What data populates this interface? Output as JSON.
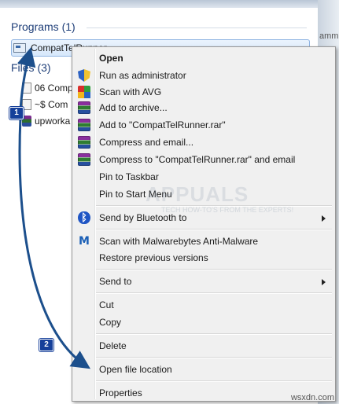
{
  "search_panel": {
    "programs_header": "Programs (1)",
    "programs": [
      {
        "name": "CompatTelRunner"
      }
    ],
    "files_header": "Files (3)",
    "files": [
      {
        "name": "06 Comp"
      },
      {
        "name": "~$ Com"
      },
      {
        "name": "upworka"
      }
    ],
    "clipped_right_text": "amm"
  },
  "context_menu": {
    "items": [
      {
        "label": "Open",
        "bold": true,
        "icon": null
      },
      {
        "label": "Run as administrator",
        "icon": "shield-icon"
      },
      {
        "label": "Scan with AVG",
        "icon": "avg-icon"
      },
      {
        "label": "Add to archive...",
        "icon": "rar-icon"
      },
      {
        "label": "Add to \"CompatTelRunner.rar\"",
        "icon": "rar-icon"
      },
      {
        "label": "Compress and email...",
        "icon": "rar-icon"
      },
      {
        "label": "Compress to \"CompatTelRunner.rar\" and email",
        "icon": "rar-icon"
      },
      {
        "label": "Pin to Taskbar",
        "icon": null
      },
      {
        "label": "Pin to Start Menu",
        "icon": null
      },
      {
        "label": "Send by Bluetooth to",
        "icon": "bluetooth-icon",
        "submenu": true
      },
      {
        "label": "Scan with Malwarebytes Anti-Malware",
        "icon": "malwarebytes-icon"
      },
      {
        "label": "Restore previous versions",
        "icon": null
      },
      {
        "label": "Send to",
        "icon": null,
        "submenu": true
      },
      {
        "label": "Cut",
        "icon": null
      },
      {
        "label": "Copy",
        "icon": null
      },
      {
        "label": "Delete",
        "icon": null
      },
      {
        "label": "Open file location",
        "icon": null
      },
      {
        "label": "Properties",
        "icon": null
      }
    ]
  },
  "annotations": {
    "step1": "1",
    "step2": "2",
    "arrow_color": "#1c4f8c"
  },
  "watermark": {
    "brand": "APPUALS",
    "tagline": "TECH HOW-TO'S FROM THE EXPERTS!"
  },
  "site_mark": "wsxdn.com"
}
